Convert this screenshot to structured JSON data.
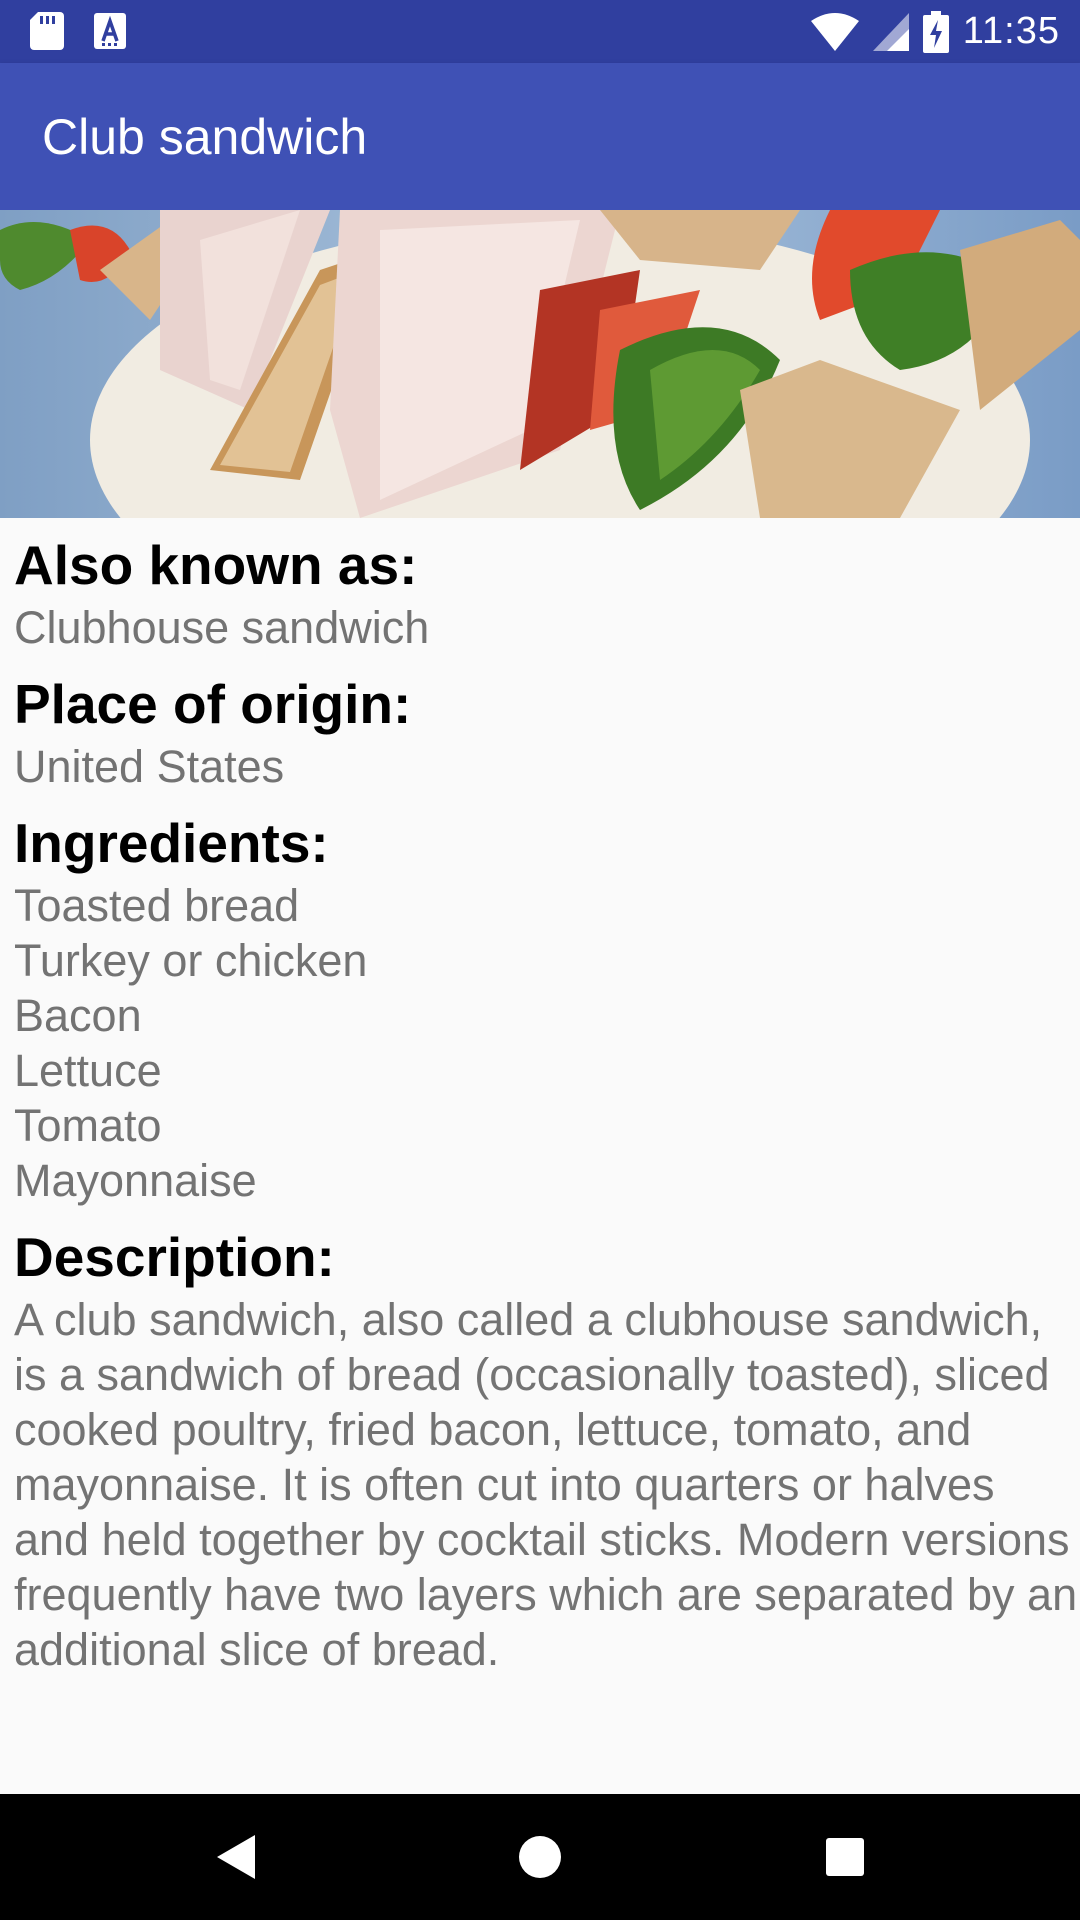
{
  "status_bar": {
    "time": "11:35",
    "left_icons": [
      "sd-card-icon",
      "text-a-icon"
    ],
    "right_icons": [
      "wifi-icon",
      "cell-signal-icon",
      "battery-charging-icon"
    ],
    "color": "#303f9f"
  },
  "app_bar": {
    "title": "Club sandwich",
    "color": "#3f51b5"
  },
  "hero_image": {
    "description_icon": "club-sandwich-photo"
  },
  "details": {
    "also_known_as_label": "Also known as:",
    "also_known_as_value": "Clubhouse sandwich",
    "origin_label": "Place of origin:",
    "origin_value": "United States",
    "ingredients_label": "Ingredients:",
    "ingredients": [
      "Toasted bread",
      "Turkey or chicken",
      "Bacon",
      "Lettuce",
      "Tomato",
      "Mayonnaise"
    ],
    "description_label": "Description:",
    "description_text": "A club sandwich, also called a clubhouse sandwich, is a sandwich of bread (occasionally toasted), sliced cooked poultry, fried bacon, lettuce, tomato, and mayonnaise. It is often cut into quarters or halves and held together by cocktail sticks. Modern versions frequently have two layers which are separated by an additional slice of bread."
  },
  "nav_bar": {
    "buttons": [
      "back-icon",
      "home-icon",
      "recents-icon"
    ]
  }
}
